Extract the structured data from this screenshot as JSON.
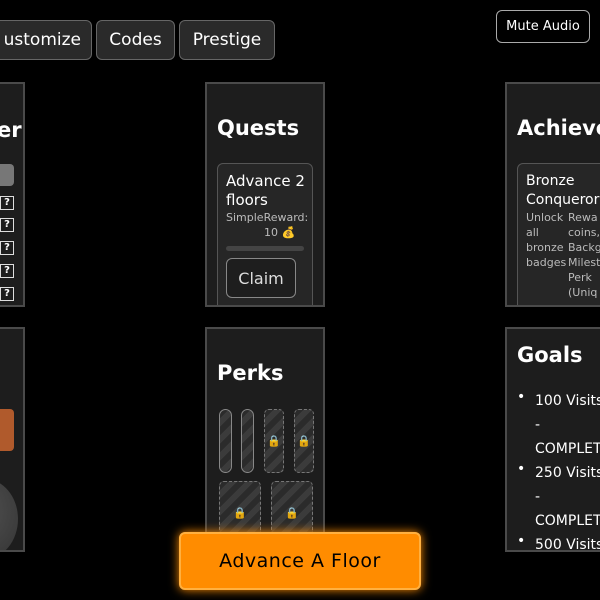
{
  "topbar": {
    "customize_label": "ustomize",
    "codes_label": "Codes",
    "prestige_label": "Prestige",
    "mute_label": "Mute Audio"
  },
  "left_panel": {
    "title_fragment": "ter",
    "badge_glyph": "?"
  },
  "quests": {
    "title": "Quests",
    "card": {
      "name_line1": "Advance 2",
      "name_line2": "floors",
      "type": "Simple",
      "reward_label": "Reward:",
      "reward_value": "10 💰",
      "progress": 0.0,
      "claim_label": "Claim"
    }
  },
  "achievements": {
    "title": "Achieve",
    "card": {
      "name_line1": "Bronze",
      "name_line2": "Conqueror",
      "desc": [
        "Unlock",
        "all",
        "bronze",
        "badges"
      ],
      "reward": [
        "Rewa",
        "coins,",
        "Backg",
        "Milest",
        "Perk",
        "(Uniq"
      ]
    }
  },
  "perks": {
    "title": "Perks",
    "lock_glyph": "🔒"
  },
  "goals": {
    "title": "Goals",
    "items": [
      {
        "count": "100 Visits",
        "dash": "-",
        "status": "COMPLETE"
      },
      {
        "count": "250 Visits",
        "dash": "-",
        "status": "COMPLETE"
      },
      {
        "count": "500 Visits"
      }
    ]
  },
  "advance_label": "Advance A Floor",
  "colors": {
    "accent": "#ff8c00",
    "panel_bg": "#1d1d1d",
    "panel_border": "#4a4a4a",
    "lock": "#f5b400"
  }
}
